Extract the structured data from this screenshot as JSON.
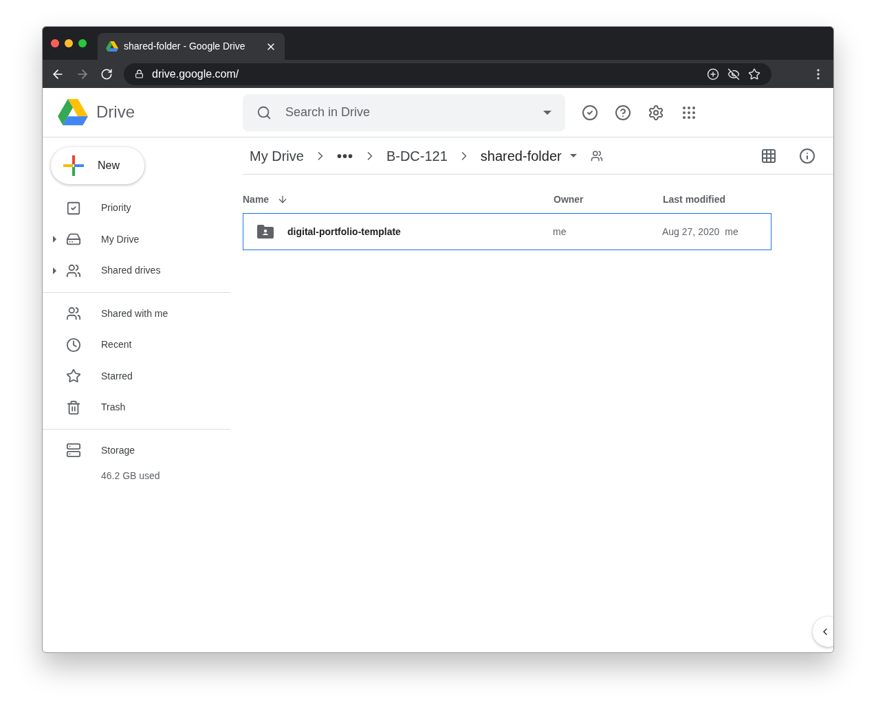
{
  "browser": {
    "tab_title": "shared-folder - Google Drive",
    "url": "drive.google.com/"
  },
  "header": {
    "app_name": "Drive",
    "search": {
      "placeholder": "Search in Drive"
    }
  },
  "sidebar": {
    "new_button": "New",
    "groups": [
      [
        {
          "label": "Priority",
          "kind": "priority",
          "expandable": false,
          "selected": false
        },
        {
          "label": "My Drive",
          "kind": "mydrive",
          "expandable": true,
          "selected": false
        },
        {
          "label": "Shared drives",
          "kind": "shareddrives",
          "expandable": true,
          "selected": false
        }
      ],
      [
        {
          "label": "Shared with me",
          "kind": "shared",
          "expandable": false,
          "selected": false
        },
        {
          "label": "Recent",
          "kind": "recent",
          "expandable": false,
          "selected": false
        },
        {
          "label": "Starred",
          "kind": "starred",
          "expandable": false,
          "selected": false
        },
        {
          "label": "Trash",
          "kind": "trash",
          "expandable": false,
          "selected": false
        }
      ],
      [
        {
          "label": "Storage",
          "kind": "storage",
          "expandable": false,
          "selected": false
        }
      ]
    ],
    "storage_used": "46.2 GB used"
  },
  "breadcrumbs": [
    "My Drive",
    "•••",
    "B-DC-121",
    "shared-folder"
  ],
  "table": {
    "columns": [
      "Name",
      "Owner",
      "Last modified"
    ],
    "rows": [
      {
        "name": "digital-portfolio-template",
        "owner": "me",
        "modified": "Aug 27, 2020",
        "modified_by": "me",
        "selected": true
      }
    ]
  }
}
